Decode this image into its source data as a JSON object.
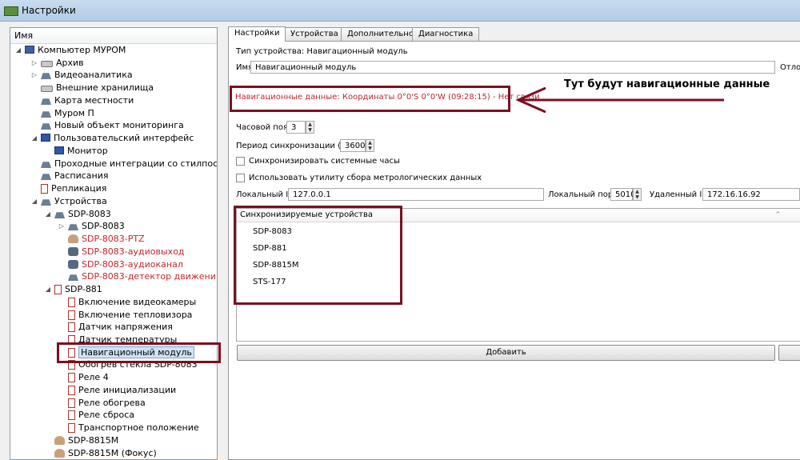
{
  "window": {
    "title": "Настройки"
  },
  "tree": {
    "header": "Имя",
    "items": [
      {
        "label": "Компьютер МУРОМ"
      },
      {
        "label": "Архив"
      },
      {
        "label": "Видеоаналитика"
      },
      {
        "label": "Внешние хранилища"
      },
      {
        "label": "Карта местности"
      },
      {
        "label": "Муром П"
      },
      {
        "label": "Новый объект мониторинга"
      },
      {
        "label": "Пользовательский интерфейс"
      },
      {
        "label": "Монитор"
      },
      {
        "label": "Проходные интеграции со стилпостом"
      },
      {
        "label": "Расписания"
      },
      {
        "label": "Репликация"
      },
      {
        "label": "Устройства"
      },
      {
        "label": "SDP-8083"
      },
      {
        "label": "SDP-8083"
      },
      {
        "label": "SDP-8083-PTZ"
      },
      {
        "label": "SDP-8083-аудиовыход"
      },
      {
        "label": "SDP-8083-аудиоканал"
      },
      {
        "label": "SDP-8083-детектор движения"
      },
      {
        "label": "SDP-881"
      },
      {
        "label": "Включение видеокамеры"
      },
      {
        "label": "Включение тепловизора"
      },
      {
        "label": "Датчик напряжения"
      },
      {
        "label": "Датчик температуры"
      },
      {
        "label": "Навигационный модуль"
      },
      {
        "label": "Обогрев стекла SDP-8083"
      },
      {
        "label": "Реле 4"
      },
      {
        "label": "Реле инициализации"
      },
      {
        "label": "Реле обогрева"
      },
      {
        "label": "Реле сброса"
      },
      {
        "label": "Транспортное положение"
      },
      {
        "label": "SDP-8815M"
      },
      {
        "label": "SDP-8815M (Фокус)"
      }
    ]
  },
  "tabs": [
    "Настройки",
    "Устройства",
    "Дополнительно",
    "Диагностика"
  ],
  "settings": {
    "device_type": "Тип устройства: Навигационный модуль",
    "name_label": "Имя",
    "name_value": "Навигационный модуль",
    "cut_label": "Отлож",
    "nav_data": "Навигационные данные: Координаты 0°0'S 0°0'W (09:28:15) - Нет связи",
    "timezone_label": "Часовой пояс",
    "timezone_value": "3",
    "sync_period_label": "Период синхронизации (сек)",
    "sync_period_value": "3600",
    "sync_clock_label": "Синхронизировать системные часы",
    "metro_label": "Использовать утилиту сбора метрологических данных",
    "local_ip_label": "Локальный IP",
    "local_ip_value": "127.0.0.1",
    "local_port_label": "Локальный порт",
    "local_port_value": "5010",
    "remote_ip_label": "Удаленный IP",
    "remote_ip_value": "172.16.16.92"
  },
  "sync": {
    "header": "Синхронизируемые устройства",
    "items": [
      "SDP-8083",
      "SDP-881",
      "SDP-8815M",
      "STS-177"
    ]
  },
  "add_button": "Добавить",
  "annotation": {
    "text": "Тут будут навигационные данные",
    "color": "#7a1020"
  }
}
